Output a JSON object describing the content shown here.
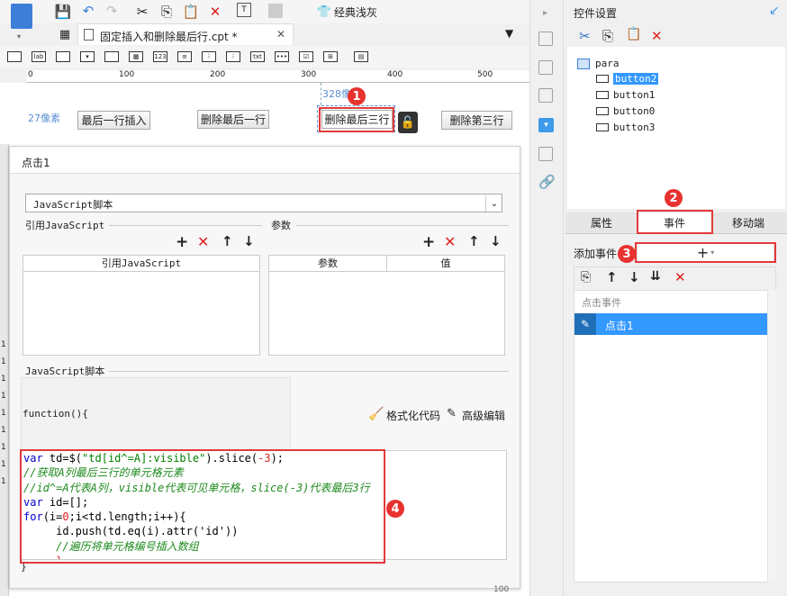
{
  "toolbar": {
    "theme_label": "经典浅灰"
  },
  "tab": {
    "file_name": "固定插入和删除最后行.cpt *"
  },
  "ruler": {
    "ticks": [
      "0",
      "100",
      "200",
      "300",
      "400",
      "500"
    ]
  },
  "design": {
    "offset_label": "27像素",
    "top_label": "328像素",
    "buttons": [
      "最后一行插入",
      "删除最后一行",
      "删除最后三行",
      "删除第三行"
    ]
  },
  "row_numbers": [
    "1",
    "1",
    "1",
    "1",
    "1",
    "1",
    "1",
    "1",
    "1"
  ],
  "dialog": {
    "title": "点击1",
    "script_type": "JavaScript脚本",
    "ref_section": "引用JavaScript",
    "param_section": "参数",
    "ref_col": "引用JavaScript",
    "param_col": "参数",
    "value_col": "值",
    "script_section": "JavaScript脚本",
    "function_header": "function(){",
    "format_code": "格式化代码",
    "advanced_edit": "高级编辑",
    "closing_brace": "}",
    "code": {
      "l1_kw": "var",
      "l1_a": " td=$(",
      "l1_str": "\"td[id^=A]:visible\"",
      "l1_b": ").slice(",
      "l1_num": "-3",
      "l1_c": ");",
      "l2": "//获取A列最后三行的单元格元素",
      "l3": "//id^=A代表A列，visible代表可见单元格，slice(-3)代表最后3行",
      "l4_kw": "var",
      "l4_a": " id=[];",
      "l5_kw": "for",
      "l5_a": "(i=",
      "l5_n1": "0",
      "l5_b": ";i<td.length;i++){",
      "l6": "     id.push(td.eq(i).attr('id'))",
      "l7": "     //遍历将单元格编号插入数组",
      "l8": "     }"
    }
  },
  "right_panel": {
    "title": "控件设置",
    "tree": {
      "root": "para",
      "items": [
        "button2",
        "button1",
        "button0",
        "button3"
      ],
      "selected": "button2"
    },
    "tabs": [
      "属性",
      "事件",
      "移动端"
    ],
    "active_tab": "事件",
    "add_event_label": "添加事件",
    "event_group": "点击事件",
    "event_item": "点击1"
  },
  "markers": [
    "1",
    "2",
    "3",
    "4"
  ],
  "colors": {
    "accent_blue": "#3d9be9",
    "marker_red": "#e8322f",
    "selection_blue": "#3399ff"
  },
  "status": {
    "zoom": "100"
  }
}
